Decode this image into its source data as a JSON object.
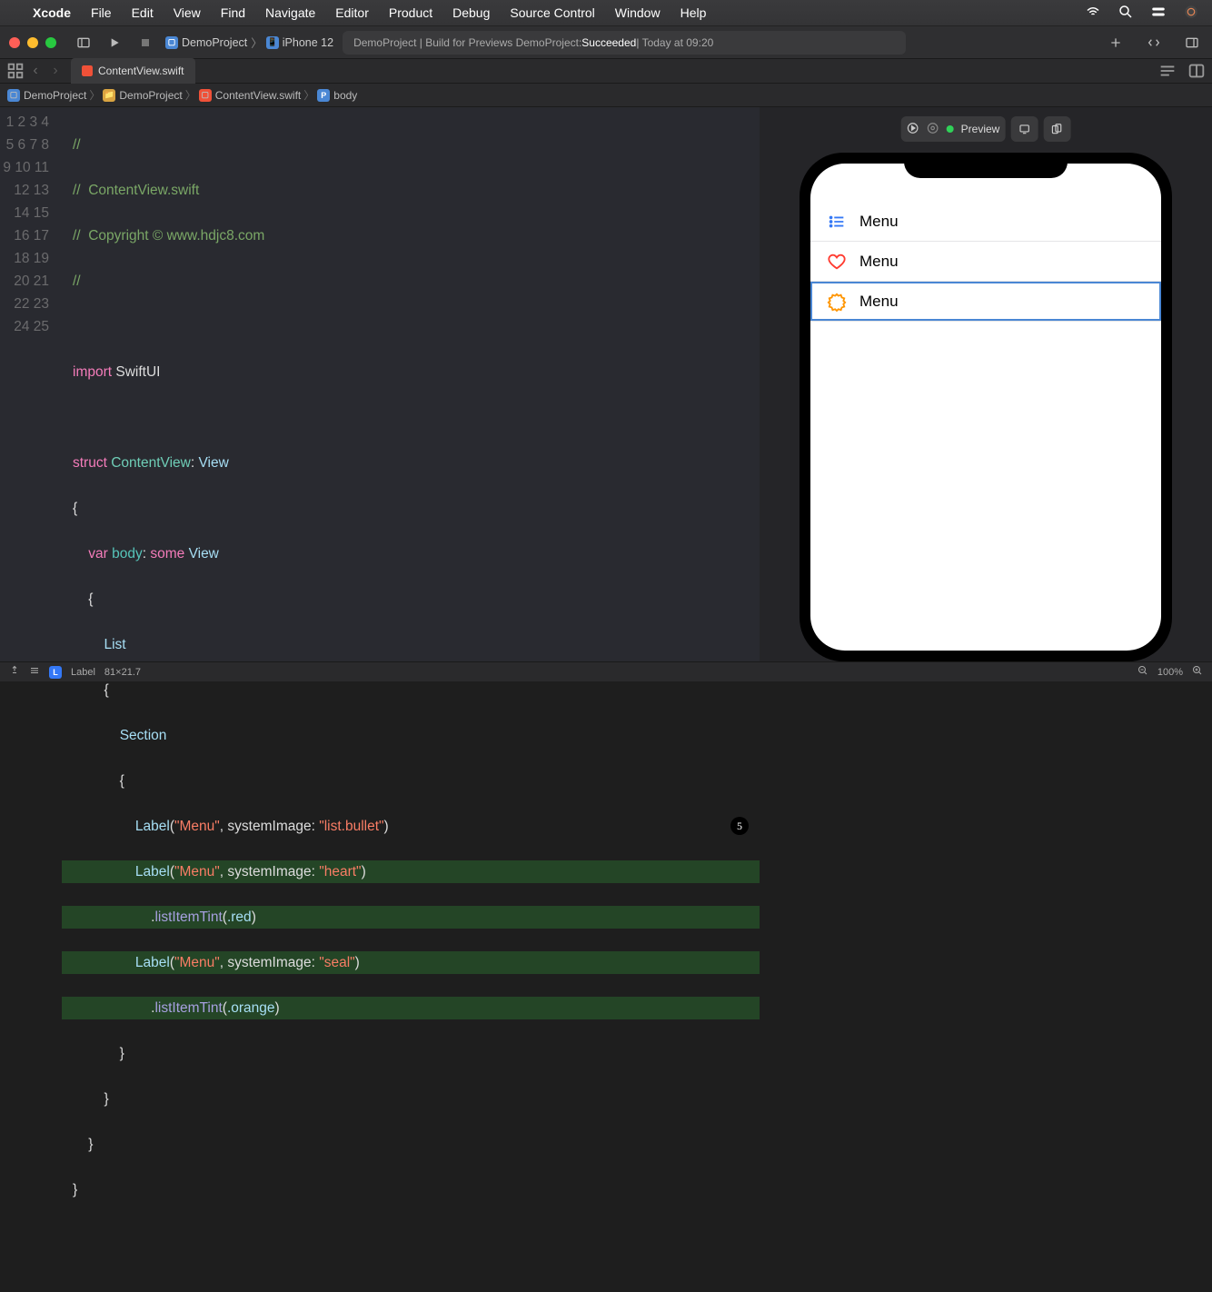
{
  "menubar": {
    "app": "Xcode",
    "items": [
      "File",
      "Edit",
      "View",
      "Find",
      "Navigate",
      "Editor",
      "Product",
      "Debug",
      "Source Control",
      "Window",
      "Help"
    ]
  },
  "toolbar": {
    "scheme_project": "DemoProject",
    "scheme_device": "iPhone 12",
    "status_prefix": "DemoProject | Build for Previews DemoProject: ",
    "status_result": "Succeeded",
    "status_time": " | Today at 09:20"
  },
  "tab": {
    "filename": "ContentView.swift"
  },
  "jumpbar": {
    "segments": [
      "DemoProject",
      "DemoProject",
      "ContentView.swift",
      "body"
    ]
  },
  "code": {
    "line1": "//",
    "line2a": "//",
    "line2b": "  ContentView.swift",
    "line3a": "//",
    "line3b": "  Copyright © www.hdjc8.com",
    "line4": "//",
    "import_kw": "import",
    "import_mod": "SwiftUI",
    "struct_kw": "struct",
    "struct_name": "ContentView",
    "view_type": "View",
    "var_kw": "var",
    "body_name": "body",
    "some_kw": "some",
    "list_type": "List",
    "section_type": "Section",
    "label_type": "Label",
    "menu_str": "\"Menu\"",
    "systemImage_label": "systemImage:",
    "si_bullet": "\"list.bullet\"",
    "si_heart": "\"heart\"",
    "si_seal": "\"seal\"",
    "tint_method": "listItemTint",
    "tint_red": ".red",
    "tint_orange": ".orange",
    "badge": "5"
  },
  "preview": {
    "preview_label": "Preview",
    "rows": [
      {
        "label": "Menu",
        "tint": "#3478f6"
      },
      {
        "label": "Menu",
        "tint": "#ff3b30"
      },
      {
        "label": "Menu",
        "tint": "#ff9500"
      }
    ]
  },
  "statusbar": {
    "element": "Label",
    "size": "81×21.7",
    "zoom": "100%"
  }
}
